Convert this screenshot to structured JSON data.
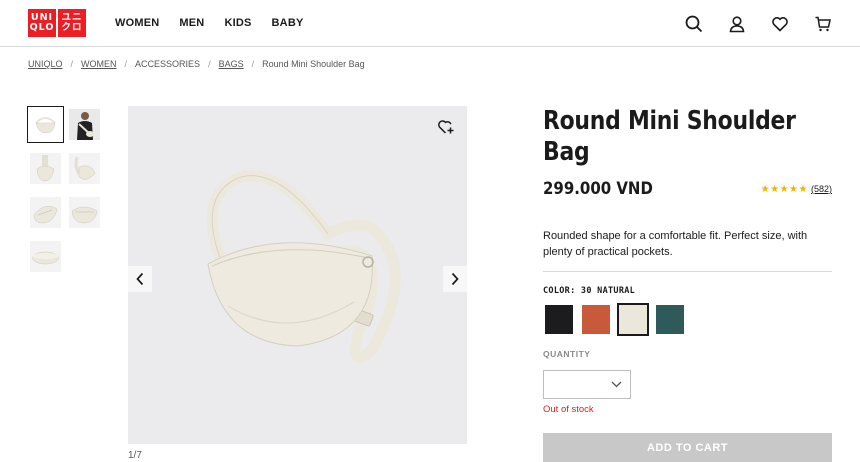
{
  "header": {
    "logo": {
      "line1": "UNI",
      "line2": "QLO",
      "line3": "ユニ",
      "line4": "クロ"
    },
    "nav": [
      "WOMEN",
      "MEN",
      "KIDS",
      "BABY"
    ],
    "icons": [
      "search-icon",
      "account-icon",
      "wishlist-icon",
      "cart-icon"
    ]
  },
  "breadcrumb": [
    {
      "label": "UNIQLO",
      "link": true
    },
    {
      "label": "WOMEN",
      "link": true
    },
    {
      "label": "ACCESSORIES",
      "link": false
    },
    {
      "label": "BAGS",
      "link": true
    },
    {
      "label": "Round Mini Shoulder Bag",
      "link": false
    }
  ],
  "gallery": {
    "counter": "1/7",
    "thumbnail_count": 7
  },
  "product": {
    "title_line1": "Round Mini Shoulder",
    "title_line2": "Bag",
    "price": "299.000 VND",
    "stars": "★★★★★",
    "reviews": "(582)",
    "description": "Rounded shape for a comfortable fit. Perfect size, with plenty of practical pockets.",
    "color_label": "COLOR: 30 NATURAL",
    "colors": [
      {
        "name": "black",
        "hex": "#1c1c1e"
      },
      {
        "name": "orange",
        "hex": "#c8593a"
      },
      {
        "name": "natural",
        "hex": "#ebe7da"
      },
      {
        "name": "green",
        "hex": "#2f5a5a"
      }
    ],
    "selected_color_index": 2,
    "quantity_label": "QUANTITY",
    "quantity_value": "",
    "stock_status": "Out of stock",
    "add_to_cart": "ADD TO CART"
  },
  "colors": {
    "brand_red": "#ed1d24",
    "stock_red": "#e02020",
    "star": "#f0b400",
    "disabled_button": "#c8c8c8"
  }
}
